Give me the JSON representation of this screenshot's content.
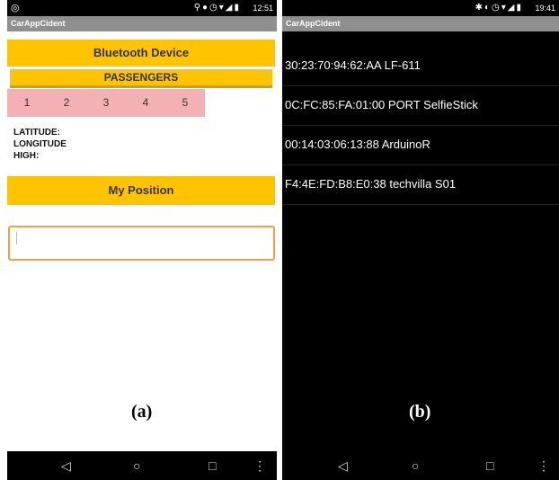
{
  "panel_a": {
    "status": {
      "left_icon": "instagram-icon",
      "icons": "location, do-not-disturb, alarm, wifi, signal, battery",
      "time": "12:51"
    },
    "app_title": "CarAppCident",
    "bluetooth_button": "Bluetooth Device",
    "passengers_label": "PASSENGERS",
    "passenger_numbers": [
      "1",
      "2",
      "3",
      "4",
      "5"
    ],
    "latitude_label": "LATITUDE:",
    "longitude_label": "LONGITUDE",
    "high_label": "HIGH:",
    "position_button": "My Position",
    "input_value": "",
    "caption": "(a)"
  },
  "panel_b": {
    "status": {
      "icons": "bluetooth, vibrate, alarm, wifi, signal, battery",
      "time": "19:41"
    },
    "app_title": "CarAppCident",
    "devices": [
      "30:23:70:94:62:AA LF-611",
      "0C:FC:85:FA:01:00 PORT SelfieStick",
      "00:14:03:06:13:88 ArduinoR",
      "F4:4E:FD:B8:E0:38 techvilla S01"
    ],
    "caption": "(b)"
  },
  "colors": {
    "accent": "#ffc400",
    "number_row": "#f4b1b5",
    "input_border": "#f1a04a",
    "appbar": "#8f8f8f"
  }
}
